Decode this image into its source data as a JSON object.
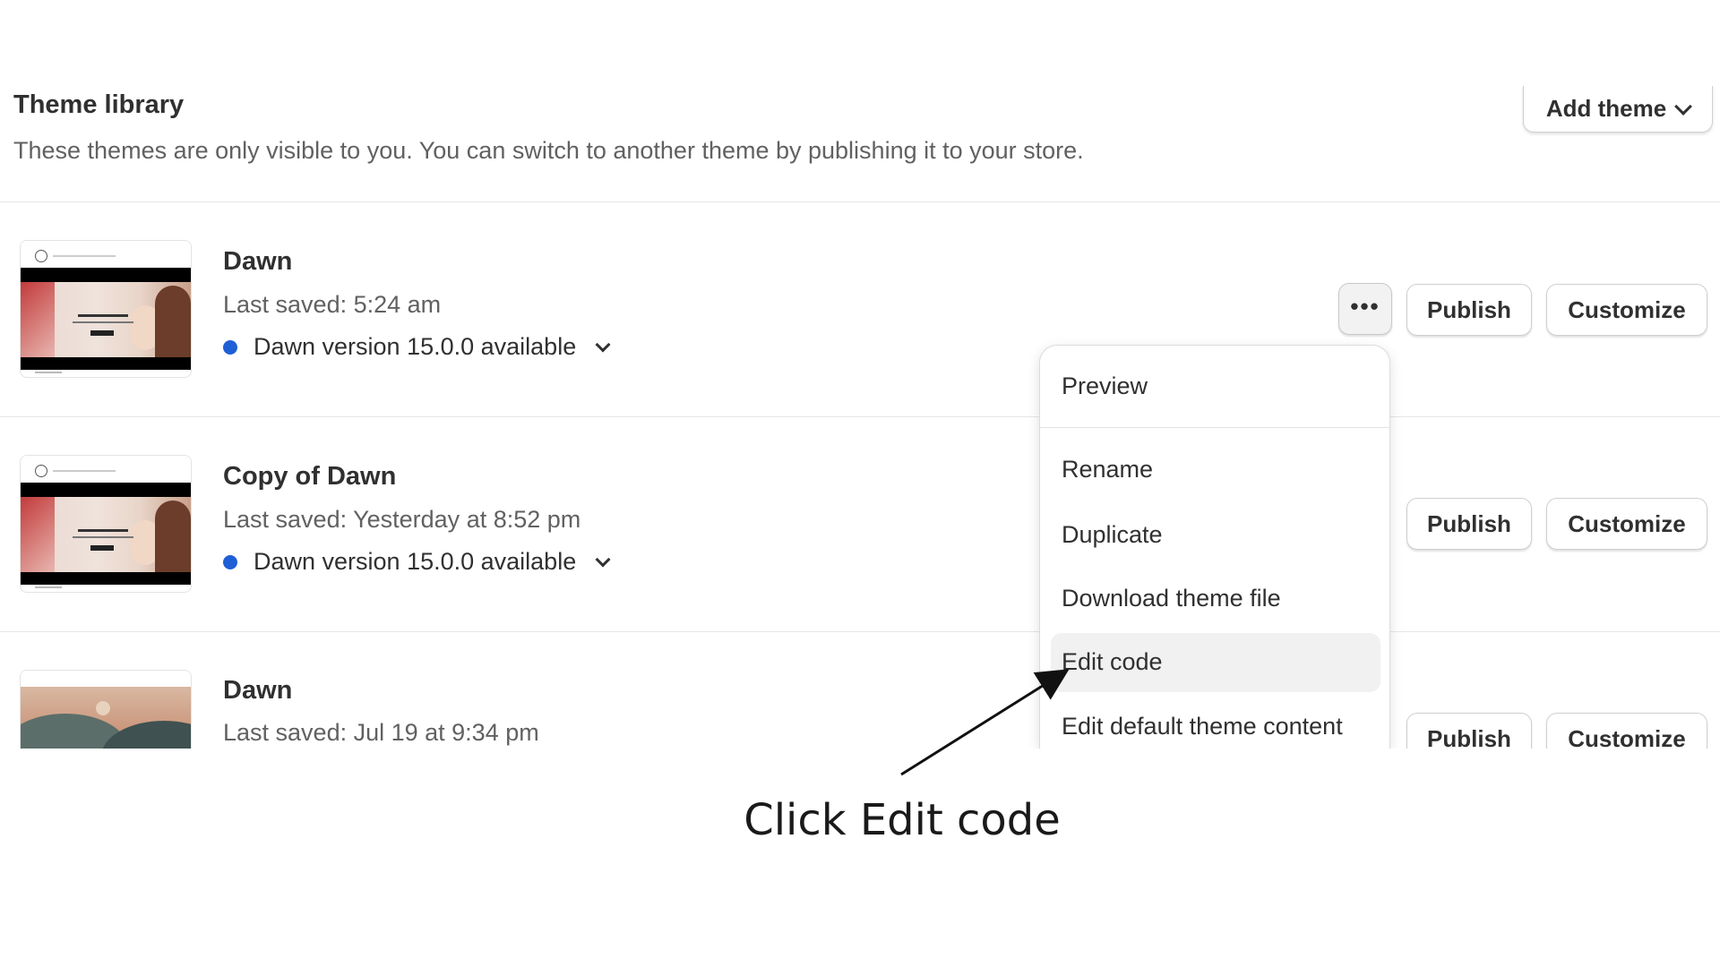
{
  "header": {
    "title": "Theme library",
    "subtitle": "These themes are only visible to you. You can switch to another theme by publishing it to your store.",
    "add_theme_label": "Add theme"
  },
  "themes": [
    {
      "name": "Dawn",
      "last_saved": "Last saved: 5:24 am",
      "version_note": "Dawn version 15.0.0 available",
      "publish_label": "Publish",
      "customize_label": "Customize"
    },
    {
      "name": "Copy of Dawn",
      "last_saved": "Last saved: Yesterday at 8:52 pm",
      "version_note": "Dawn version 15.0.0 available",
      "publish_label": "Publish",
      "customize_label": "Customize"
    },
    {
      "name": "Dawn",
      "last_saved": "Last saved: Jul 19 at 9:34 pm",
      "publish_label": "Publish",
      "customize_label": "Customize"
    }
  ],
  "more_actions_icon": "ellipsis-icon",
  "menu": {
    "items": [
      "Preview",
      "Rename",
      "Duplicate",
      "Download theme file",
      "Edit code",
      "Edit default theme content"
    ],
    "highlighted": "Edit code"
  },
  "annotation": {
    "caption": "Click Edit code"
  },
  "colors": {
    "version_dot": "#1f5fd6",
    "menu_highlight": "#f1f1f1"
  }
}
